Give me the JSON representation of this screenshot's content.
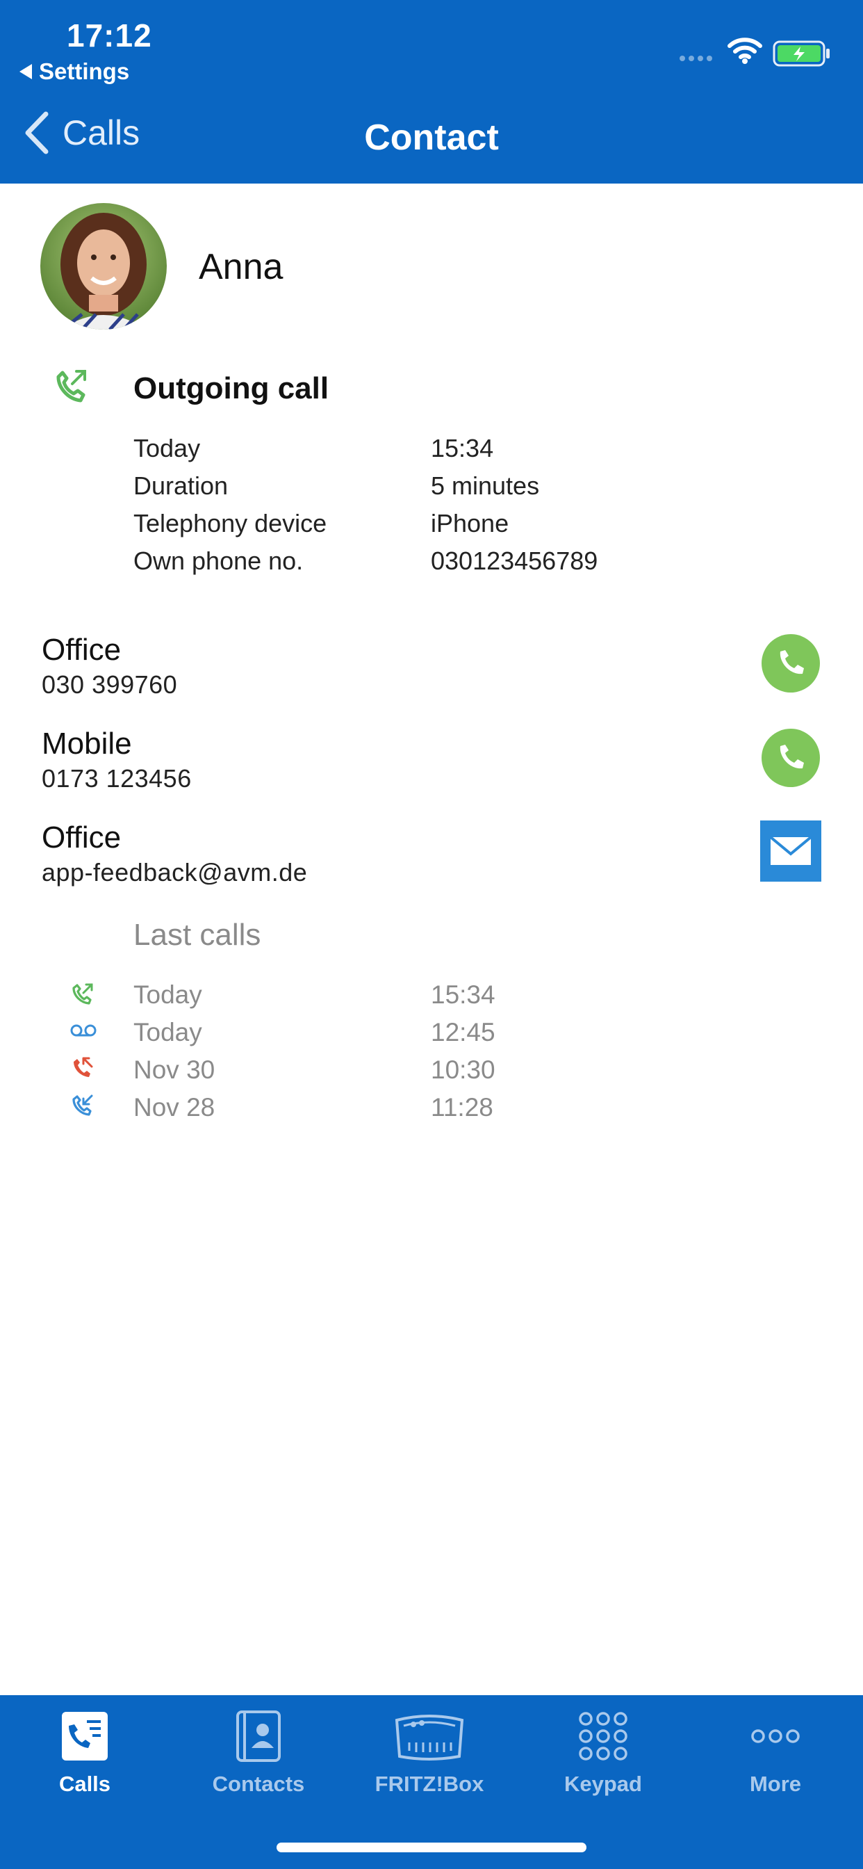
{
  "status_bar": {
    "time": "17:12",
    "back_app": "Settings",
    "battery_color": "#4cd964"
  },
  "nav": {
    "back_label": "Calls",
    "title": "Contact"
  },
  "contact": {
    "name": "Anna"
  },
  "call_detail": {
    "type": "Outgoing call",
    "icon": "outgoing-call-icon",
    "rows": [
      {
        "label": "Today",
        "value": "15:34"
      },
      {
        "label": "Duration",
        "value": "5 minutes"
      },
      {
        "label": "Telephony device",
        "value": "iPhone"
      },
      {
        "label": "Own phone no.",
        "value": "030123456789"
      }
    ]
  },
  "entries": [
    {
      "label": "Office",
      "value": "030 399760",
      "action": "phone-icon"
    },
    {
      "label": "Mobile",
      "value": "0173 123456",
      "action": "phone-icon"
    },
    {
      "label": "Office",
      "value": "app-feedback@avm.de",
      "action": "mail-icon"
    }
  ],
  "last_calls": {
    "title": "Last calls",
    "items": [
      {
        "date": "Today",
        "time": "15:34",
        "icon": "outgoing-call-icon",
        "color": "#5cb85c"
      },
      {
        "date": "Today",
        "time": "12:45",
        "icon": "voicemail-icon",
        "color": "#3a8fd8"
      },
      {
        "date": "Nov 30",
        "time": "10:30",
        "icon": "missed-call-icon",
        "color": "#e0523a"
      },
      {
        "date": "Nov 28",
        "time": "11:28",
        "icon": "incoming-call-icon",
        "color": "#3a8fd8"
      }
    ]
  },
  "tabs": [
    {
      "label": "Calls",
      "icon": "calls-list-icon",
      "active": true
    },
    {
      "label": "Contacts",
      "icon": "contacts-book-icon",
      "active": false
    },
    {
      "label": "FRITZ!Box",
      "icon": "fritzbox-icon",
      "active": false
    },
    {
      "label": "Keypad",
      "icon": "keypad-icon",
      "active": false
    },
    {
      "label": "More",
      "icon": "more-dots-icon",
      "active": false
    }
  ],
  "colors": {
    "brand_blue": "#0a66c2",
    "call_green": "#7fc65a",
    "mail_blue": "#2a8ad8"
  }
}
